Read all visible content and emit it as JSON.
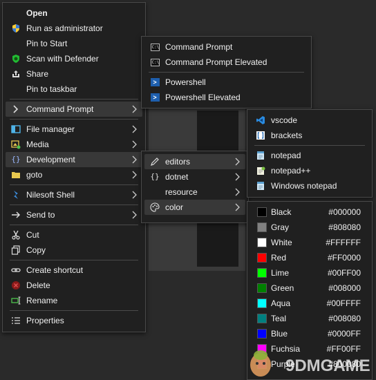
{
  "main_menu": {
    "items": [
      {
        "label": "Open",
        "icon": "none"
      },
      {
        "label": "Run as administrator",
        "icon": "shield-icon"
      },
      {
        "label": "Pin to Start",
        "icon": "none"
      },
      {
        "label": "Scan with Defender",
        "icon": "defender-icon"
      },
      {
        "label": "Share",
        "icon": "share-icon"
      },
      {
        "label": "Pin to taskbar",
        "icon": "none"
      },
      {
        "label": "Command Prompt",
        "icon": "chevron-icon"
      },
      {
        "label": "File manager",
        "icon": "file-manager-icon"
      },
      {
        "label": "Media",
        "icon": "media-icon"
      },
      {
        "label": "Development",
        "icon": "braces-icon"
      },
      {
        "label": "goto",
        "icon": "folder-icon"
      },
      {
        "label": "Nilesoft Shell",
        "icon": "nilesoft-icon"
      },
      {
        "label": "Send to",
        "icon": "send-icon"
      },
      {
        "label": "Cut",
        "icon": "scissors-icon"
      },
      {
        "label": "Copy",
        "icon": "copy-icon"
      },
      {
        "label": "Create shortcut",
        "icon": "link-icon"
      },
      {
        "label": "Delete",
        "icon": "delete-icon"
      },
      {
        "label": "Rename",
        "icon": "rename-icon"
      },
      {
        "label": "Properties",
        "icon": "properties-icon"
      }
    ]
  },
  "terminal_menu": {
    "items": [
      {
        "label": "Command Prompt",
        "icon": "cmd-icon"
      },
      {
        "label": "Command Prompt Elevated",
        "icon": "cmd-icon"
      },
      {
        "label": "Powershell",
        "icon": "powershell-icon"
      },
      {
        "label": "Powershell Elevated",
        "icon": "powershell-icon"
      }
    ]
  },
  "dev_menu": {
    "items": [
      {
        "label": "editors",
        "icon": "pencil-icon"
      },
      {
        "label": "dotnet",
        "icon": "braces-icon"
      },
      {
        "label": "resource",
        "icon": "none"
      },
      {
        "label": "color",
        "icon": "palette-icon"
      }
    ]
  },
  "editors_menu": {
    "items": [
      {
        "label": "vscode",
        "icon": "vscode-icon"
      },
      {
        "label": "brackets",
        "icon": "brackets-icon"
      },
      {
        "label": "notepad",
        "icon": "notepad-icon"
      },
      {
        "label": "notepad++",
        "icon": "notepadpp-icon"
      },
      {
        "label": "Windows notepad",
        "icon": "notepad-icon"
      }
    ]
  },
  "color_menu": {
    "items": [
      {
        "name": "Black",
        "hex": "#000000",
        "color": "#000000"
      },
      {
        "name": "Gray",
        "hex": "#808080",
        "color": "#808080"
      },
      {
        "name": "White",
        "hex": "#FFFFFF",
        "color": "#FFFFFF"
      },
      {
        "name": "Red",
        "hex": "#FF0000",
        "color": "#FF0000"
      },
      {
        "name": "Lime",
        "hex": "#00FF00",
        "color": "#00FF00"
      },
      {
        "name": "Green",
        "hex": "#008000",
        "color": "#008000"
      },
      {
        "name": "Aqua",
        "hex": "#00FFFF",
        "color": "#00FFFF"
      },
      {
        "name": "Teal",
        "hex": "#008080",
        "color": "#008080"
      },
      {
        "name": "Blue",
        "hex": "#0000FF",
        "color": "#0000FF"
      },
      {
        "name": "Fuchsia",
        "hex": "#FF00FF",
        "color": "#FF00FF"
      },
      {
        "name": "Purple",
        "hex": "#800080",
        "color": "#800080"
      }
    ]
  },
  "watermark": {
    "text": "9DMGAME"
  }
}
